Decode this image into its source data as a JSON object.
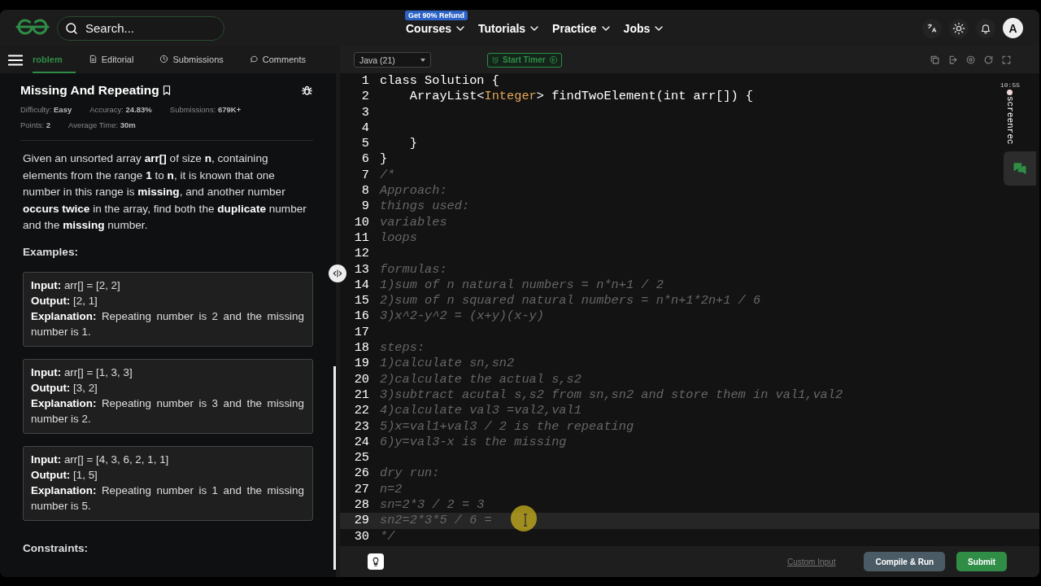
{
  "nav": {
    "search_placeholder": "Search...",
    "badge": "Get 90% Refund",
    "menu": [
      {
        "label": "Courses"
      },
      {
        "label": "Tutorials"
      },
      {
        "label": "Practice"
      },
      {
        "label": "Jobs"
      }
    ],
    "avatar": "A"
  },
  "problem_tabs": [
    {
      "label": "roblem",
      "selected": true
    },
    {
      "label": "Editorial",
      "selected": false
    },
    {
      "label": "Submissions",
      "selected": false
    },
    {
      "label": "Comments",
      "selected": false
    }
  ],
  "problem": {
    "title": "Missing And Repeating",
    "meta": [
      [
        "Difficulty: **Easy**",
        "Accuracy: **24.83%**",
        "Submissions: **679K+**"
      ],
      [
        "Points: **2**",
        "Average Time: **30m**"
      ]
    ],
    "description": "Given an unsorted array **arr[]** of size **n**, containing elements from the range **1** to **n**, it is known that one number in this range is **missing**, and another number **occurs twice** in the array, find both the **duplicate** number and the **missing** number.",
    "examples_heading": "Examples:",
    "examples": [
      {
        "input": "**Input:** arr[] = [2, 2]",
        "output": "**Output:** [2, 1]",
        "explanation": "**Explanation:** Repeating number is 2 and the missing number is 1."
      },
      {
        "input": "**Input:** arr[] = [1, 3, 3]",
        "output": "**Output:** [3, 2]",
        "explanation": "**Explanation:** Repeating number is 3 and the missing number is 2."
      },
      {
        "input": "**Input:** arr[] = [4, 3, 6, 2, 1, 1]",
        "output": "**Output:** [1, 5]",
        "explanation": "**Explanation:** Repeating number is 1 and the missing number is 5."
      }
    ],
    "constraints_heading": "Constraints:"
  },
  "editor": {
    "language": "Java (21)",
    "timer": "Start Timer",
    "lines": [
      {
        "number": "1",
        "active": false,
        "segments": [
          {
            "text": "class Solution {",
            "kind": "plain"
          }
        ]
      },
      {
        "number": "2",
        "active": false,
        "segments": [
          {
            "text": "    ArrayList<",
            "kind": "plain"
          },
          {
            "text": "Integer",
            "kind": "type"
          },
          {
            "text": "> findTwoElement(int arr[]) {",
            "kind": "plain"
          }
        ]
      },
      {
        "number": "3",
        "active": false
      },
      {
        "number": "4",
        "active": false
      },
      {
        "number": "5",
        "active": false,
        "segments": [
          {
            "text": "    }",
            "kind": "plain"
          }
        ]
      },
      {
        "number": "6",
        "active": false,
        "segments": [
          {
            "text": "}",
            "kind": "plain"
          }
        ]
      },
      {
        "number": "7",
        "active": false,
        "segments": [
          {
            "text": "/*",
            "kind": "comment"
          }
        ]
      },
      {
        "number": "8",
        "active": false,
        "segments": [
          {
            "text": "Approach:",
            "kind": "comment"
          }
        ]
      },
      {
        "number": "9",
        "active": false,
        "segments": [
          {
            "text": "things used:",
            "kind": "comment"
          }
        ]
      },
      {
        "number": "10",
        "active": false,
        "segments": [
          {
            "text": "variables",
            "kind": "comment"
          }
        ]
      },
      {
        "number": "11",
        "active": false,
        "segments": [
          {
            "text": "loops",
            "kind": "comment"
          }
        ]
      },
      {
        "number": "12",
        "active": false
      },
      {
        "number": "13",
        "active": false,
        "segments": [
          {
            "text": "formulas:",
            "kind": "comment"
          }
        ]
      },
      {
        "number": "14",
        "active": false,
        "segments": [
          {
            "text": "1)sum of n natural numbers = n*n+1 / 2",
            "kind": "comment"
          }
        ]
      },
      {
        "number": "15",
        "active": false,
        "segments": [
          {
            "text": "2)sum of n squared natural numbers = n*n+1*2n+1 / 6",
            "kind": "comment"
          }
        ]
      },
      {
        "number": "16",
        "active": false,
        "segments": [
          {
            "text": "3)x^2-y^2 = (x+y)(x-y)",
            "kind": "comment"
          }
        ]
      },
      {
        "number": "17",
        "active": false
      },
      {
        "number": "18",
        "active": false,
        "segments": [
          {
            "text": "steps:",
            "kind": "comment"
          }
        ]
      },
      {
        "number": "19",
        "active": false,
        "segments": [
          {
            "text": "1)calculate sn,sn2",
            "kind": "comment"
          }
        ]
      },
      {
        "number": "20",
        "active": false,
        "segments": [
          {
            "text": "2)calculate the actual s,s2",
            "kind": "comment"
          }
        ]
      },
      {
        "number": "21",
        "active": false,
        "segments": [
          {
            "text": "3)subtract acutal s,s2 from sn,sn2 and store them in val1,val2",
            "kind": "comment"
          }
        ]
      },
      {
        "number": "22",
        "active": false,
        "segments": [
          {
            "text": "4)calculate val3 =val2,val1",
            "kind": "comment"
          }
        ]
      },
      {
        "number": "23",
        "active": false,
        "segments": [
          {
            "text": "5)x=val1+val3 / 2 is the repeating",
            "kind": "comment"
          }
        ]
      },
      {
        "number": "24",
        "active": false,
        "segments": [
          {
            "text": "6)y=val3-x is the missing",
            "kind": "comment"
          }
        ]
      },
      {
        "number": "25",
        "active": false
      },
      {
        "number": "26",
        "active": false,
        "segments": [
          {
            "text": "dry run:",
            "kind": "comment"
          }
        ]
      },
      {
        "number": "27",
        "active": false,
        "segments": [
          {
            "text": "n=2",
            "kind": "comment"
          }
        ]
      },
      {
        "number": "28",
        "active": false,
        "segments": [
          {
            "text": "sn=2*3 / 2 = 3",
            "kind": "comment"
          }
        ]
      },
      {
        "number": "29",
        "active": true,
        "segments": [
          {
            "text": "sn2=2*3*5 / 6 =",
            "kind": "comment"
          }
        ]
      },
      {
        "number": "30",
        "active": false,
        "segments": [
          {
            "text": "*/",
            "kind": "comment"
          }
        ]
      }
    ],
    "custom_input": "Custom Input",
    "buttons": [
      {
        "label": "Compile & Run",
        "kind": "secondary"
      },
      {
        "label": "Submit",
        "kind": "primary"
      }
    ]
  },
  "screen_recorder": {
    "time": "10:55",
    "label": "screenrec"
  }
}
